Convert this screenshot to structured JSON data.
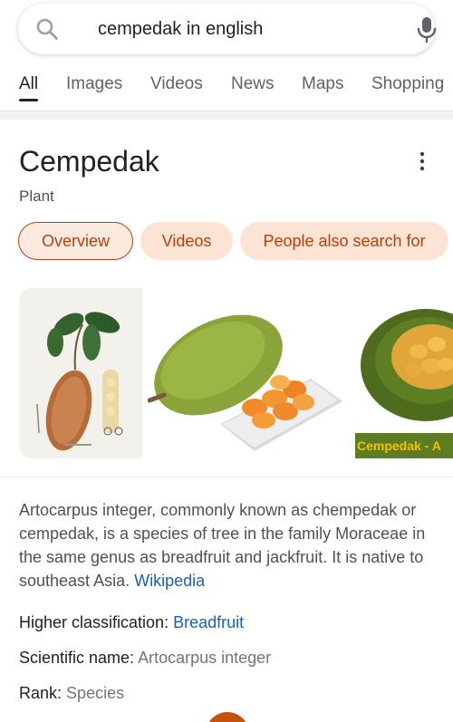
{
  "search": {
    "query": "cempedak in english"
  },
  "tabs": [
    {
      "label": "All",
      "active": true
    },
    {
      "label": "Images"
    },
    {
      "label": "Videos"
    },
    {
      "label": "News"
    },
    {
      "label": "Maps"
    },
    {
      "label": "Shopping"
    }
  ],
  "entity": {
    "title": "Cempedak",
    "subtitle": "Plant",
    "chips": [
      "Overview",
      "Videos",
      "People also search for"
    ],
    "image_label": "Cempedak - A",
    "description": "Artocarpus integer, commonly known as chempedak or cempedak, is a species of tree in the family Moraceae in the same genus as breadfruit and jackfruit. It is native to southeast Asia.",
    "source_link": "Wikipedia",
    "facts": [
      {
        "label": "Higher classification:",
        "value": "Breadfruit",
        "is_link": true
      },
      {
        "label": "Scientific name:",
        "value": "Artocarpus integer",
        "is_link": false
      },
      {
        "label": "Rank:",
        "value": "Species",
        "is_link": false
      }
    ]
  },
  "colors": {
    "chip_bg": "#fde3d3",
    "chip_text": "#b3410f",
    "link": "#1a5fb4",
    "fab": "#c4520f"
  }
}
